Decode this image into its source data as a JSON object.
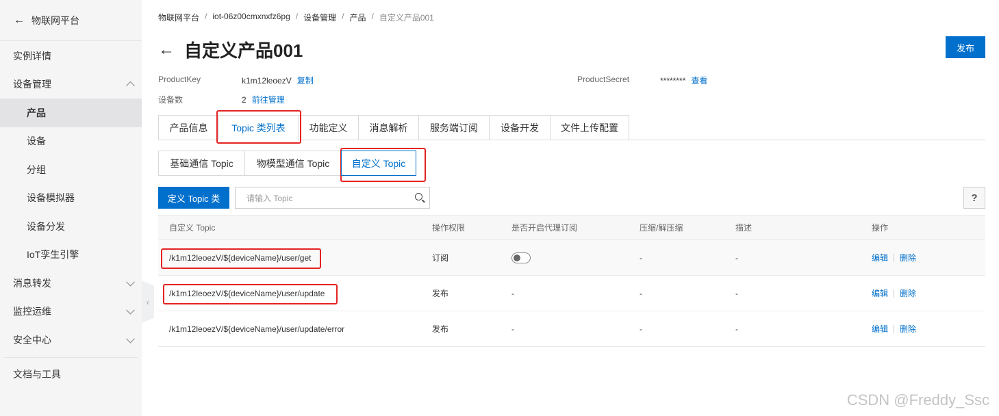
{
  "sidebar": {
    "back_title": "物联网平台",
    "items": [
      {
        "label": "实例详情"
      },
      {
        "label": "设备管理"
      },
      {
        "label": "产品"
      },
      {
        "label": "设备"
      },
      {
        "label": "分组"
      },
      {
        "label": "设备模拟器"
      },
      {
        "label": "设备分发"
      },
      {
        "label": "IoT孪生引擎"
      },
      {
        "label": "消息转发"
      },
      {
        "label": "监控运维"
      },
      {
        "label": "安全中心"
      },
      {
        "label": "文档与工具"
      }
    ]
  },
  "breadcrumb": {
    "items": [
      "物联网平台",
      "iot-06z00cmxnxfz6pg",
      "设备管理",
      "产品",
      "自定义产品001"
    ],
    "separator": "/"
  },
  "header": {
    "title": "自定义产品001",
    "publish_label": "发布"
  },
  "info": {
    "product_key_label": "ProductKey",
    "product_key_value": "k1m12leoezV",
    "copy_label": "复制",
    "device_count_label": "设备数",
    "device_count_value": "2",
    "manage_label": "前往管理",
    "product_secret_label": "ProductSecret",
    "product_secret_value": "********",
    "view_label": "查看"
  },
  "tabs": [
    "产品信息",
    "Topic 类列表",
    "功能定义",
    "消息解析",
    "服务端订阅",
    "设备开发",
    "文件上传配置"
  ],
  "subtabs": [
    "基础通信 Topic",
    "物模型通信 Topic",
    "自定义 Topic"
  ],
  "toolbar": {
    "define_label": "定义 Topic 类",
    "search_placeholder": "请输入 Topic",
    "help_label": "?"
  },
  "table": {
    "headers": [
      "自定义 Topic",
      "操作权限",
      "是否开启代理订阅",
      "压缩/解压缩",
      "描述",
      "操作"
    ],
    "rows": [
      {
        "topic": "/k1m12leoezV/${deviceName}/user/get",
        "permission": "订阅",
        "proxy": "toggle-off",
        "compress": "-",
        "desc": "-",
        "edit": "编辑",
        "delete": "删除"
      },
      {
        "topic": "/k1m12leoezV/${deviceName}/user/update",
        "permission": "发布",
        "proxy": "-",
        "compress": "-",
        "desc": "-",
        "edit": "编辑",
        "delete": "删除"
      },
      {
        "topic": "/k1m12leoezV/${deviceName}/user/update/error",
        "permission": "发布",
        "proxy": "-",
        "compress": "-",
        "desc": "-",
        "edit": "编辑",
        "delete": "删除"
      }
    ]
  },
  "watermark": "CSDN @Freddy_Ssc",
  "colors": {
    "primary": "#0070cc",
    "accent": "#ff6a00",
    "annotation": "#e52222"
  }
}
